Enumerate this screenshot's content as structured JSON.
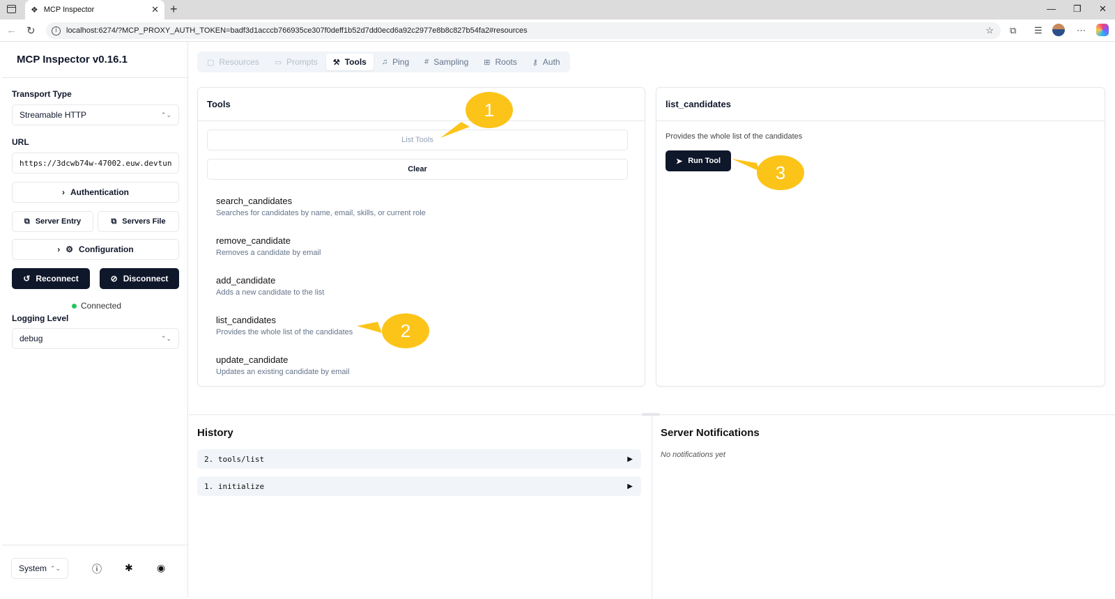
{
  "browser": {
    "tab_title": "MCP Inspector",
    "url": "localhost:6274/?MCP_PROXY_AUTH_TOKEN=badf3d1acccb766935ce307f0deff1b52d7dd0ecd6a92c2977e8b8c827b54fa2#resources"
  },
  "sidebar": {
    "title": "MCP Inspector v0.16.1",
    "transport_label": "Transport Type",
    "transport_value": "Streamable HTTP",
    "url_label": "URL",
    "url_value": "https://3dcwb74w-47002.euw.devtunn",
    "authentication_label": "Authentication",
    "server_entry_label": "Server Entry",
    "servers_file_label": "Servers File",
    "configuration_label": "Configuration",
    "reconnect_label": "Reconnect",
    "disconnect_label": "Disconnect",
    "status_text": "Connected",
    "logging_label": "Logging Level",
    "logging_value": "debug",
    "theme_value": "System"
  },
  "tabs": [
    {
      "label": "Resources",
      "icon": "file-icon",
      "state": "disabled"
    },
    {
      "label": "Prompts",
      "icon": "message-icon",
      "state": "disabled"
    },
    {
      "label": "Tools",
      "icon": "hammer-icon",
      "state": "active"
    },
    {
      "label": "Ping",
      "icon": "bell-icon",
      "state": "normal"
    },
    {
      "label": "Sampling",
      "icon": "hash-icon",
      "state": "normal"
    },
    {
      "label": "Roots",
      "icon": "folder-tree-icon",
      "state": "normal"
    },
    {
      "label": "Auth",
      "icon": "key-icon",
      "state": "normal"
    }
  ],
  "tools_panel": {
    "title": "Tools",
    "list_tools_label": "List Tools",
    "clear_label": "Clear",
    "tools": [
      {
        "name": "search_candidates",
        "description": "Searches for candidates by name, email, skills, or current role"
      },
      {
        "name": "remove_candidate",
        "description": "Removes a candidate by email"
      },
      {
        "name": "add_candidate",
        "description": "Adds a new candidate to the list"
      },
      {
        "name": "list_candidates",
        "description": "Provides the whole list of the candidates"
      },
      {
        "name": "update_candidate",
        "description": "Updates an existing candidate by email"
      }
    ]
  },
  "detail_panel": {
    "title": "list_candidates",
    "description": "Provides the whole list of the candidates",
    "run_label": "Run Tool"
  },
  "history": {
    "title": "History",
    "items": [
      "2. tools/list",
      "1. initialize"
    ]
  },
  "notifications": {
    "title": "Server Notifications",
    "empty_text": "No notifications yet"
  },
  "callouts": [
    "1",
    "2",
    "3"
  ],
  "colors": {
    "primary_dark": "#0f172a",
    "connected_green": "#22c55e",
    "callout_yellow": "#fcc419"
  }
}
